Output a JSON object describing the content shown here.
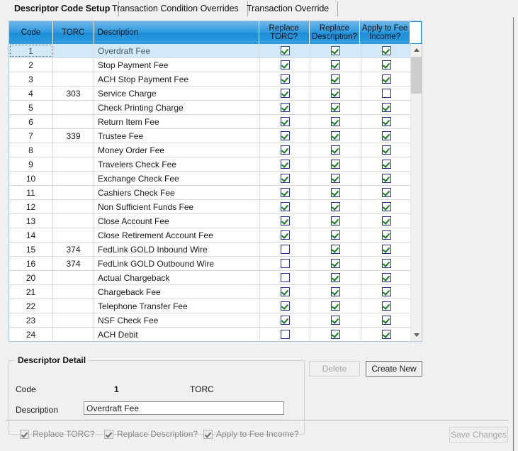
{
  "window": {
    "title": "Descriptor Code Setup"
  },
  "tabs": [
    {
      "label": "Descriptor Code Setup",
      "active": true
    },
    {
      "label": "Transaction Condition Overrides",
      "active": false
    },
    {
      "label": "Transaction Override",
      "active": false
    }
  ],
  "grid": {
    "columns": [
      {
        "key": "code",
        "label": "Code"
      },
      {
        "key": "torc",
        "label": "TORC"
      },
      {
        "key": "description",
        "label": "Description"
      },
      {
        "key": "replace_torc",
        "label": "Replace\nTORC?"
      },
      {
        "key": "replace_description",
        "label": "Replace\nDescription?"
      },
      {
        "key": "apply_to_fee_income",
        "label": "Apply to Fee\nIncome?"
      }
    ],
    "column_labels": {
      "code": "Code",
      "torc": "TORC",
      "description": "Description",
      "replace_torc_l1": "Replace",
      "replace_torc_l2": "TORC?",
      "replace_description_l1": "Replace",
      "replace_description_l2": "Description?",
      "apply_fee_l1": "Apply to Fee",
      "apply_fee_l2": "Income?"
    },
    "rows": [
      {
        "code": "1",
        "torc": "",
        "description": "Overdraft Fee",
        "replace_torc": true,
        "replace_description": true,
        "apply_to_fee_income": true,
        "selected": true
      },
      {
        "code": "2",
        "torc": "",
        "description": "Stop Payment Fee",
        "replace_torc": true,
        "replace_description": true,
        "apply_to_fee_income": true,
        "selected": false
      },
      {
        "code": "3",
        "torc": "",
        "description": "ACH Stop Payment Fee",
        "replace_torc": true,
        "replace_description": true,
        "apply_to_fee_income": true,
        "selected": false
      },
      {
        "code": "4",
        "torc": "303",
        "description": "Service Charge",
        "replace_torc": true,
        "replace_description": true,
        "apply_to_fee_income": false,
        "selected": false
      },
      {
        "code": "5",
        "torc": "",
        "description": "Check Printing Charge",
        "replace_torc": true,
        "replace_description": true,
        "apply_to_fee_income": true,
        "selected": false
      },
      {
        "code": "6",
        "torc": "",
        "description": "Return Item Fee",
        "replace_torc": true,
        "replace_description": true,
        "apply_to_fee_income": true,
        "selected": false
      },
      {
        "code": "7",
        "torc": "339",
        "description": "Trustee Fee",
        "replace_torc": true,
        "replace_description": true,
        "apply_to_fee_income": true,
        "selected": false
      },
      {
        "code": "8",
        "torc": "",
        "description": "Money Order Fee",
        "replace_torc": true,
        "replace_description": true,
        "apply_to_fee_income": true,
        "selected": false
      },
      {
        "code": "9",
        "torc": "",
        "description": "Travelers Check Fee",
        "replace_torc": true,
        "replace_description": true,
        "apply_to_fee_income": true,
        "selected": false
      },
      {
        "code": "10",
        "torc": "",
        "description": "Exchange Check Fee",
        "replace_torc": true,
        "replace_description": true,
        "apply_to_fee_income": true,
        "selected": false
      },
      {
        "code": "11",
        "torc": "",
        "description": "Cashiers Check Fee",
        "replace_torc": true,
        "replace_description": true,
        "apply_to_fee_income": true,
        "selected": false
      },
      {
        "code": "12",
        "torc": "",
        "description": "Non Sufficient Funds Fee",
        "replace_torc": true,
        "replace_description": true,
        "apply_to_fee_income": true,
        "selected": false
      },
      {
        "code": "13",
        "torc": "",
        "description": "Close Account Fee",
        "replace_torc": true,
        "replace_description": true,
        "apply_to_fee_income": true,
        "selected": false
      },
      {
        "code": "14",
        "torc": "",
        "description": "Close Retirement Account Fee",
        "replace_torc": true,
        "replace_description": true,
        "apply_to_fee_income": true,
        "selected": false
      },
      {
        "code": "15",
        "torc": "374",
        "description": "FedLink GOLD Inbound Wire",
        "replace_torc": false,
        "replace_description": true,
        "apply_to_fee_income": true,
        "selected": false
      },
      {
        "code": "16",
        "torc": "374",
        "description": "FedLink GOLD Outbound Wire",
        "replace_torc": false,
        "replace_description": true,
        "apply_to_fee_income": true,
        "selected": false
      },
      {
        "code": "20",
        "torc": "",
        "description": "Actual Chargeback",
        "replace_torc": false,
        "replace_description": true,
        "apply_to_fee_income": true,
        "selected": false
      },
      {
        "code": "21",
        "torc": "",
        "description": "Chargeback Fee",
        "replace_torc": true,
        "replace_description": true,
        "apply_to_fee_income": true,
        "selected": false
      },
      {
        "code": "22",
        "torc": "",
        "description": "Telephone Transfer Fee",
        "replace_torc": true,
        "replace_description": true,
        "apply_to_fee_income": true,
        "selected": false
      },
      {
        "code": "23",
        "torc": "",
        "description": "NSF Check Fee",
        "replace_torc": true,
        "replace_description": true,
        "apply_to_fee_income": true,
        "selected": false
      },
      {
        "code": "24",
        "torc": "",
        "description": "ACH Debit",
        "replace_torc": false,
        "replace_description": true,
        "apply_to_fee_income": true,
        "selected": false
      }
    ],
    "scrollbar": {
      "up_icon": "chevron-up-icon",
      "down_icon": "chevron-down-icon"
    }
  },
  "detail": {
    "legend": "Descriptor Detail",
    "code_label": "Code",
    "code_value": "1",
    "torc_label": "TORC",
    "torc_value": "",
    "description_label": "Description",
    "description_value": "Overdraft Fee",
    "description_placeholder": "",
    "checkboxes": [
      {
        "label": "Replace TORC?",
        "checked": true,
        "disabled": true
      },
      {
        "label": "Replace Description?",
        "checked": true,
        "disabled": true
      },
      {
        "label": "Apply to Fee Income?",
        "checked": true,
        "disabled": true
      }
    ]
  },
  "buttons": {
    "delete": {
      "label": "Delete",
      "disabled": true
    },
    "create_new": {
      "label": "Create New",
      "disabled": false
    },
    "save_changes": {
      "label": "Save Changes",
      "disabled": true
    }
  },
  "colors": {
    "header_blue": "#2e9adf",
    "selection_blue": "#d4e9f7",
    "check_green": "#157a20",
    "checkbox_border": "#26348e",
    "window_bg": "#f0f0f0"
  }
}
